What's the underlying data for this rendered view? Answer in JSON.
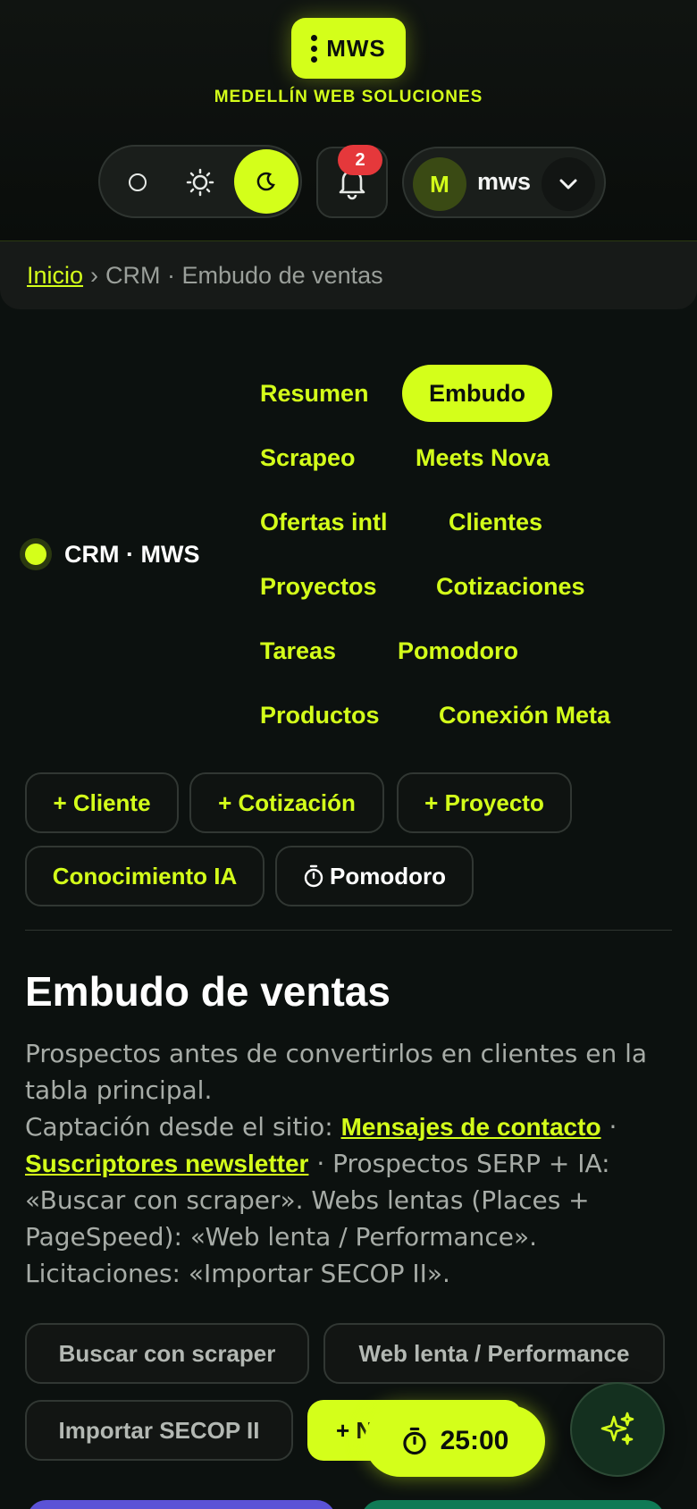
{
  "header": {
    "logo_text": "MWS",
    "brand_subtitle": "MEDELLÍN WEB SOLUCIONES",
    "theme_options": [
      "system-icon",
      "sun-icon",
      "moon-icon"
    ],
    "notifications_count": "2",
    "user": {
      "initial": "M",
      "name": "mws"
    }
  },
  "breadcrumb": {
    "home": "Inicio",
    "separator": "›",
    "current": "CRM · Embudo de ventas"
  },
  "crm": {
    "label": "CRM · MWS",
    "nav": [
      "Resumen",
      "Embudo",
      "Scrapeo",
      "Meets Nova",
      "Ofertas intl",
      "Clientes",
      "Proyectos",
      "Cotizaciones",
      "Tareas",
      "Pomodoro",
      "Productos",
      "Conexión Meta"
    ],
    "active": "Embudo"
  },
  "actions": {
    "cliente": "+ Cliente",
    "cotizacion": "+ Cotización",
    "proyecto": "+ Proyecto",
    "conocimiento": "Conocimiento IA",
    "pomodoro": "Pomodoro"
  },
  "main": {
    "title": "Embudo de ventas",
    "desc_line1": "Prospectos antes de convertirlos en clientes en la tabla principal.",
    "desc_capt": "Captación desde el sitio: ",
    "link_contact": "Mensajes de contacto",
    "dot": " · ",
    "link_newsletter": "Suscriptores newsletter",
    "desc_rest": " · Prospectos SERP + IA: «Buscar con scraper». Webs lentas (Places + PageSpeed): «Web lenta / Performance». Licitaciones: «Importar SECOP II».",
    "btn_scraper": "Buscar con scraper",
    "btn_web_lenta": "Web lenta / Performance",
    "btn_secop": "Importar SECOP II",
    "btn_new": "+ N"
  },
  "timer": {
    "value": "25:00"
  },
  "colors": {
    "accent": "#d4ff1a",
    "background": "#0c110f",
    "badge": "#e5383b"
  }
}
